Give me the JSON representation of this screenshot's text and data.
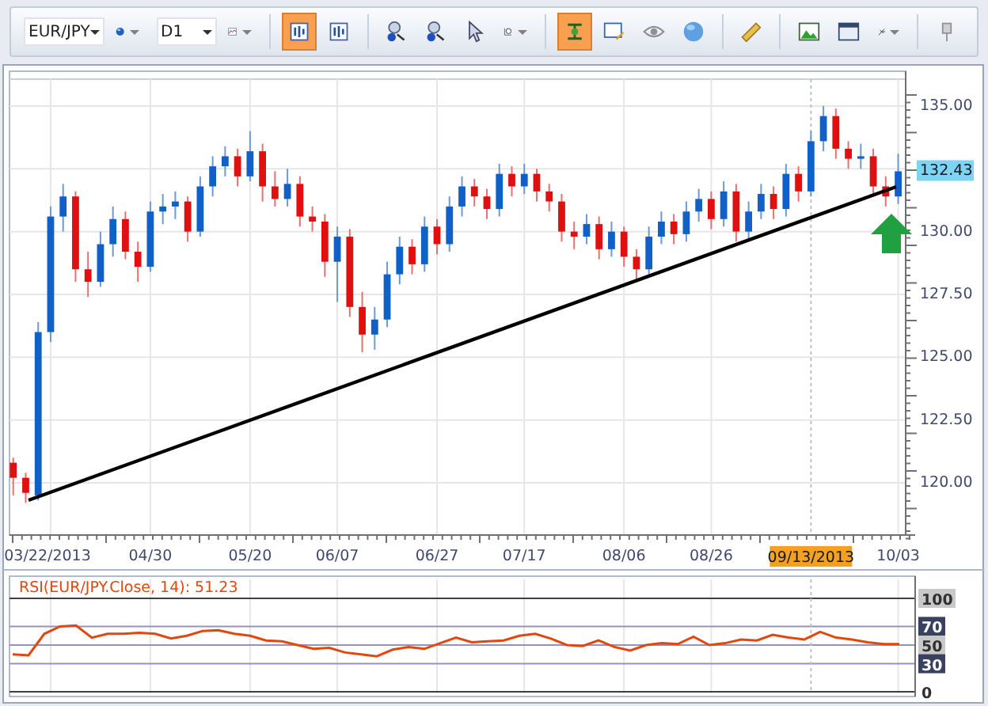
{
  "toolbar": {
    "symbol": "EUR/JPY",
    "timeframe": "D1",
    "tools": [
      {
        "selected": false,
        "menu": true
      },
      {
        "selected": false,
        "menu": true
      },
      {
        "selected": true,
        "menu": false
      },
      {
        "selected": false,
        "menu": false
      },
      {
        "selected": false,
        "menu": false
      },
      {
        "selected": false,
        "menu": false
      },
      {
        "selected": false,
        "menu": false
      },
      {
        "selected": false,
        "menu": true
      },
      {
        "selected": true,
        "menu": false
      },
      {
        "selected": false,
        "menu": false
      },
      {
        "selected": false,
        "menu": false
      },
      {
        "selected": false,
        "menu": false
      },
      {
        "selected": false,
        "menu": false
      },
      {
        "selected": false,
        "menu": false
      },
      {
        "selected": false,
        "menu": false
      },
      {
        "selected": false,
        "menu": true
      },
      {
        "selected": false,
        "menu": false
      }
    ]
  },
  "price_chart": {
    "current_price": "132.43",
    "cursor_date": "09/13/2013",
    "chart_data": {
      "type": "candlestick",
      "grid": true,
      "ylim": [
        117.92,
        136.07
      ],
      "categories": [
        null,
        null,
        null,
        "03/22/2013",
        null,
        null,
        null,
        null,
        null,
        null,
        null,
        "04/30",
        null,
        null,
        null,
        null,
        null,
        null,
        null,
        "05/20",
        null,
        null,
        null,
        null,
        null,
        null,
        "06/07",
        null,
        null,
        null,
        null,
        null,
        null,
        null,
        "06/27",
        null,
        null,
        null,
        null,
        null,
        null,
        "07/17",
        null,
        null,
        null,
        null,
        null,
        null,
        null,
        "08/06",
        null,
        null,
        null,
        null,
        null,
        null,
        "08/26",
        null,
        null,
        null,
        null,
        null,
        null,
        null,
        null,
        null,
        null,
        null,
        null,
        null,
        null,
        "10/03"
      ],
      "yticks": [
        {
          "value": 135,
          "label": "135.00"
        },
        {
          "value": 130,
          "label": "130.00"
        },
        {
          "value": 127.5,
          "label": "127.50"
        },
        {
          "value": 125,
          "label": "125.00"
        },
        {
          "value": 122.5,
          "label": "122.50"
        },
        {
          "value": 120,
          "label": "120.00"
        }
      ],
      "ohlc": [
        [
          120.8,
          121.0,
          119.5,
          120.2
        ],
        [
          120.2,
          120.4,
          119.2,
          119.6
        ],
        [
          119.5,
          126.4,
          119.3,
          126.0
        ],
        [
          126.0,
          131.0,
          125.6,
          130.6
        ],
        [
          130.6,
          131.9,
          130.0,
          131.4
        ],
        [
          131.4,
          131.6,
          128.0,
          128.5
        ],
        [
          128.5,
          129.2,
          127.4,
          128.0
        ],
        [
          128.0,
          130.0,
          127.8,
          129.5
        ],
        [
          129.5,
          131.0,
          129.0,
          130.5
        ],
        [
          130.5,
          130.8,
          128.9,
          129.2
        ],
        [
          129.2,
          129.6,
          128.0,
          128.6
        ],
        [
          128.6,
          131.2,
          128.4,
          130.8
        ],
        [
          130.8,
          131.5,
          130.3,
          131.0
        ],
        [
          131.0,
          131.6,
          130.5,
          131.2
        ],
        [
          131.2,
          131.4,
          129.6,
          130.0
        ],
        [
          130.0,
          132.2,
          129.8,
          131.8
        ],
        [
          131.8,
          133.0,
          131.4,
          132.6
        ],
        [
          132.6,
          133.4,
          132.2,
          133.0
        ],
        [
          133.0,
          133.3,
          131.8,
          132.2
        ],
        [
          132.2,
          134.0,
          132.0,
          133.2
        ],
        [
          133.2,
          133.5,
          131.2,
          131.8
        ],
        [
          131.8,
          132.4,
          131.0,
          131.3
        ],
        [
          131.3,
          132.5,
          131.0,
          131.9
        ],
        [
          131.9,
          132.2,
          130.2,
          130.6
        ],
        [
          130.6,
          131.0,
          130.0,
          130.4
        ],
        [
          130.4,
          130.7,
          128.2,
          128.8
        ],
        [
          128.8,
          130.2,
          127.2,
          129.8
        ],
        [
          129.8,
          130.1,
          126.6,
          127.0
        ],
        [
          127.0,
          127.6,
          125.2,
          125.9
        ],
        [
          125.9,
          127.0,
          125.3,
          126.5
        ],
        [
          126.5,
          128.8,
          126.2,
          128.3
        ],
        [
          128.3,
          129.8,
          127.9,
          129.4
        ],
        [
          129.4,
          129.7,
          128.3,
          128.7
        ],
        [
          128.7,
          130.6,
          128.4,
          130.2
        ],
        [
          130.2,
          130.5,
          129.1,
          129.5
        ],
        [
          129.5,
          131.4,
          129.2,
          131.0
        ],
        [
          131.0,
          132.2,
          130.6,
          131.8
        ],
        [
          131.8,
          132.1,
          131.0,
          131.4
        ],
        [
          131.4,
          131.7,
          130.5,
          130.9
        ],
        [
          130.9,
          132.7,
          130.6,
          132.3
        ],
        [
          132.3,
          132.6,
          131.4,
          131.8
        ],
        [
          131.8,
          132.7,
          131.5,
          132.3
        ],
        [
          132.3,
          132.5,
          131.2,
          131.6
        ],
        [
          131.6,
          131.9,
          130.8,
          131.2
        ],
        [
          131.2,
          131.5,
          129.6,
          130.0
        ],
        [
          130.0,
          130.4,
          129.3,
          129.8
        ],
        [
          129.8,
          130.7,
          129.5,
          130.3
        ],
        [
          130.3,
          130.6,
          128.9,
          129.3
        ],
        [
          129.3,
          130.4,
          129.0,
          130.0
        ],
        [
          130.0,
          130.2,
          128.6,
          129.0
        ],
        [
          129.0,
          129.3,
          128.1,
          128.5
        ],
        [
          128.5,
          130.2,
          128.3,
          129.8
        ],
        [
          129.8,
          130.8,
          129.5,
          130.4
        ],
        [
          130.4,
          130.7,
          129.5,
          129.9
        ],
        [
          129.9,
          131.2,
          129.6,
          130.8
        ],
        [
          130.8,
          131.7,
          130.4,
          131.3
        ],
        [
          131.3,
          131.6,
          130.1,
          130.5
        ],
        [
          130.5,
          132.0,
          130.2,
          131.6
        ],
        [
          131.6,
          131.9,
          129.6,
          130.0
        ],
        [
          130.0,
          131.2,
          129.7,
          130.8
        ],
        [
          130.8,
          131.9,
          130.5,
          131.5
        ],
        [
          131.5,
          131.8,
          130.5,
          130.9
        ],
        [
          130.9,
          132.7,
          130.6,
          132.3
        ],
        [
          132.3,
          132.6,
          131.2,
          131.6
        ],
        [
          131.6,
          134.0,
          131.4,
          133.6
        ],
        [
          133.6,
          135.0,
          133.2,
          134.6
        ],
        [
          134.6,
          134.9,
          132.9,
          133.3
        ],
        [
          133.3,
          133.6,
          132.5,
          132.9
        ],
        [
          132.9,
          133.5,
          132.5,
          133.0
        ],
        [
          133.0,
          133.3,
          131.4,
          131.8
        ],
        [
          131.8,
          132.2,
          131.0,
          131.4
        ],
        [
          131.4,
          133.1,
          131.1,
          132.4
        ]
      ]
    }
  },
  "rsi_panel": {
    "chart_data": {
      "type": "line",
      "ylim": [
        0,
        100
      ],
      "grid": true,
      "yticks": [
        {
          "value": 100,
          "label": "100"
        },
        {
          "value": 70,
          "label": "70"
        },
        {
          "value": 50,
          "label": "50"
        },
        {
          "value": 30,
          "label": "30"
        },
        {
          "value": 0,
          "label": "0"
        }
      ],
      "series": [
        {
          "name": "RSI(EUR/JPY.Close, 14): 51.23",
          "color": "#e04810",
          "values": [
            40,
            39,
            62,
            70,
            71,
            58,
            62,
            62,
            63,
            62,
            57,
            60,
            65,
            66,
            62,
            60,
            55,
            54,
            50,
            46,
            47,
            42,
            40,
            38,
            45,
            48,
            46,
            52,
            58,
            53,
            54,
            55,
            60,
            62,
            57,
            50,
            49,
            55,
            48,
            44,
            50,
            52,
            51,
            59,
            50,
            52,
            56,
            55,
            61,
            58,
            56,
            64,
            58,
            56,
            53,
            51,
            51
          ]
        }
      ]
    }
  }
}
